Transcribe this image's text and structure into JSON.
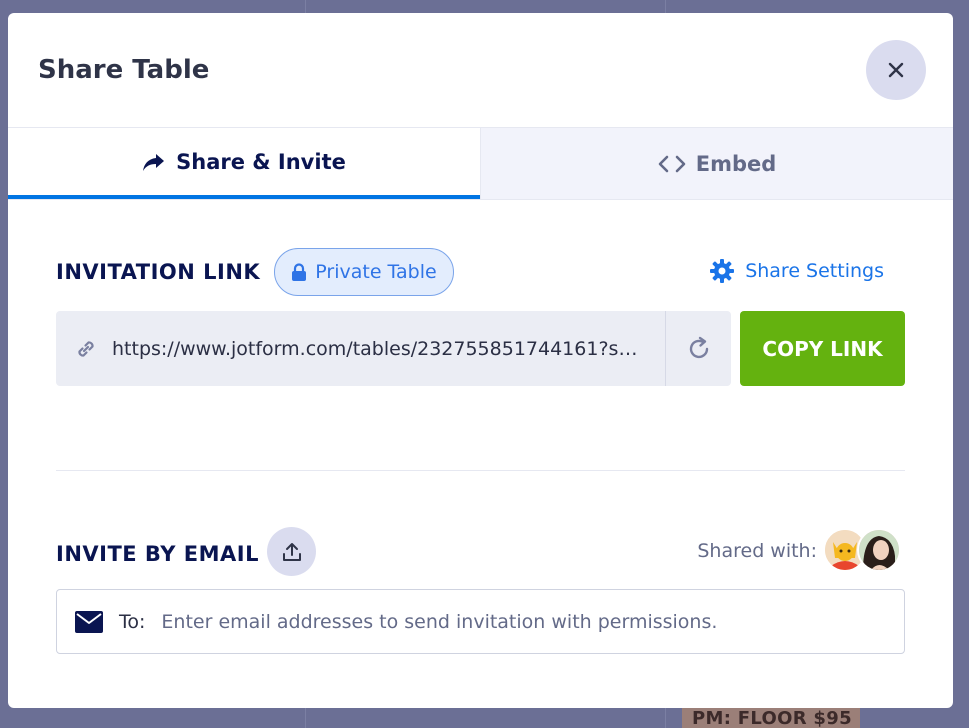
{
  "modal": {
    "title": "Share Table"
  },
  "tabs": [
    {
      "label": "Share & Invite",
      "icon": "share-arrow-icon",
      "active": true
    },
    {
      "label": "Embed",
      "icon": "code-icon",
      "active": false
    }
  ],
  "invitation": {
    "title": "INVITATION LINK",
    "privacy_label": "Private Table",
    "settings_label": "Share Settings",
    "link": "https://www.jotform.com/tables/232755851744161?st...",
    "copy_label": "COPY LINK"
  },
  "invite_email": {
    "title": "INVITE BY EMAIL",
    "shared_with_label": "Shared with:",
    "to_label": "To:",
    "placeholder": "Enter email addresses to send invitation with permissions."
  },
  "background": {
    "tag_text": "PM: FLOOR $95"
  },
  "colors": {
    "accent": "#0075e3",
    "copy_button": "#64b20f",
    "heading": "#0a1551",
    "link_blue": "#1a74e8"
  }
}
